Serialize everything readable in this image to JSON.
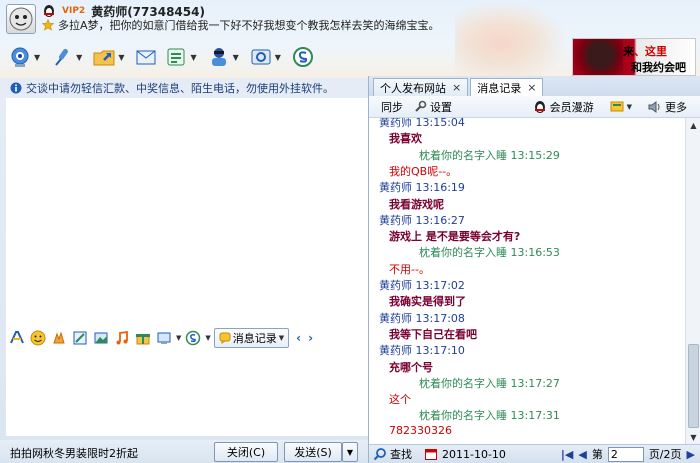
{
  "header": {
    "vip_label": "VIP2",
    "nickname": "黄药师(77348454)",
    "signature": "多拉A梦，把你的如意门借给我一下好不好我想变个教我怎样去笑的海绵宝宝。",
    "ad_line1_prefix": "来",
    "ad_line1_red": "、这里",
    "ad_line2": "和我约会吧~"
  },
  "toolbar": {
    "icons": [
      "video-icon",
      "voice-icon",
      "file-transfer-icon",
      "mail-icon",
      "app-icon",
      "group-icon",
      "settings-icon",
      "safety-icon"
    ]
  },
  "left": {
    "notice": "交谈中请勿轻信汇款、中奖信息、陌生电话，勿使用外挂软件。",
    "msg_record_label": "消息记录",
    "bottom_ad": "拍拍网秋冬男装限时2折起",
    "close_label": "关闭(C)",
    "send_label": "发送(S)"
  },
  "right": {
    "tabs": [
      {
        "label": "个人发布网站"
      },
      {
        "label": "消息记录"
      }
    ],
    "toolbar": {
      "sync_label": "同步",
      "settings_label": "设置",
      "roaming_label": "会员漫游",
      "more_label": "更多"
    },
    "messages": [
      {
        "kind": "header_a",
        "text": "黄药师 13:15:04"
      },
      {
        "kind": "bold",
        "text": "我喜欢"
      },
      {
        "kind": "header_b",
        "text": "枕着你的名字入睡 13:15:29"
      },
      {
        "kind": "red",
        "text": "我的QB呢--。"
      },
      {
        "kind": "header_a",
        "text": "黄药师 13:16:19"
      },
      {
        "kind": "bold",
        "text": "我看游戏呢"
      },
      {
        "kind": "header_a",
        "text": "黄药师 13:16:27"
      },
      {
        "kind": "bold",
        "text": "游戏上  是不是要等会才有?"
      },
      {
        "kind": "header_b",
        "text": "枕着你的名字入睡 13:16:53"
      },
      {
        "kind": "red",
        "text": "不用--。"
      },
      {
        "kind": "header_a",
        "text": "黄药师 13:17:02"
      },
      {
        "kind": "bold",
        "text": "我确实是得到了"
      },
      {
        "kind": "header_a",
        "text": "黄药师 13:17:08"
      },
      {
        "kind": "bold",
        "text": "我等下自己在看吧"
      },
      {
        "kind": "header_a",
        "text": "黄药师 13:17:10"
      },
      {
        "kind": "bold",
        "text": "充哪个号"
      },
      {
        "kind": "header_b",
        "text": "枕着你的名字入睡 13:17:27"
      },
      {
        "kind": "red",
        "text": "这个"
      },
      {
        "kind": "header_b",
        "text": "枕着你的名字入睡 13:17:31"
      },
      {
        "kind": "red",
        "text": "782330326"
      }
    ],
    "bottom": {
      "search_label": "查找",
      "date": "2011-10-10",
      "page_prefix": "第",
      "page_value": "2",
      "page_suffix": "页/2页"
    }
  },
  "colors": {
    "sender_a": "#1f3f98",
    "sender_b": "#2e8a57",
    "self_text": "#7a0030",
    "peer_text": "#d10000"
  }
}
